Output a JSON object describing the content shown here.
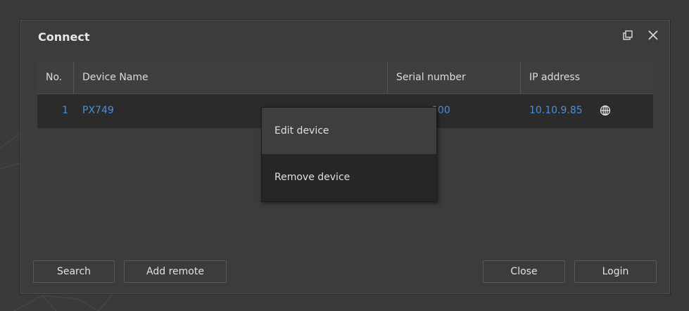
{
  "dialog": {
    "title": "Connect",
    "restore_icon": "restore-window-icon",
    "close_icon": "close-icon"
  },
  "table": {
    "headers": {
      "no": "No.",
      "device_name": "Device Name",
      "serial_number": "Serial number",
      "ip_address": "IP address"
    },
    "rows": [
      {
        "no": "1",
        "device_name": "PX749",
        "serial_number": "000",
        "ip_address": "10.10.9.85",
        "ip_icon": "globe-icon"
      }
    ]
  },
  "context_menu": {
    "items": [
      {
        "label": "Edit device"
      },
      {
        "label": "Remove device"
      }
    ]
  },
  "buttons": {
    "search": "Search",
    "add_remote": "Add remote",
    "close": "Close",
    "login": "Login"
  },
  "colors": {
    "background": "#3a3a3a",
    "dialog": "#3c3c3c",
    "link_blue": "#4a90d9",
    "menu_highlight": "#3e3e3e",
    "menu_bg": "#262626"
  }
}
